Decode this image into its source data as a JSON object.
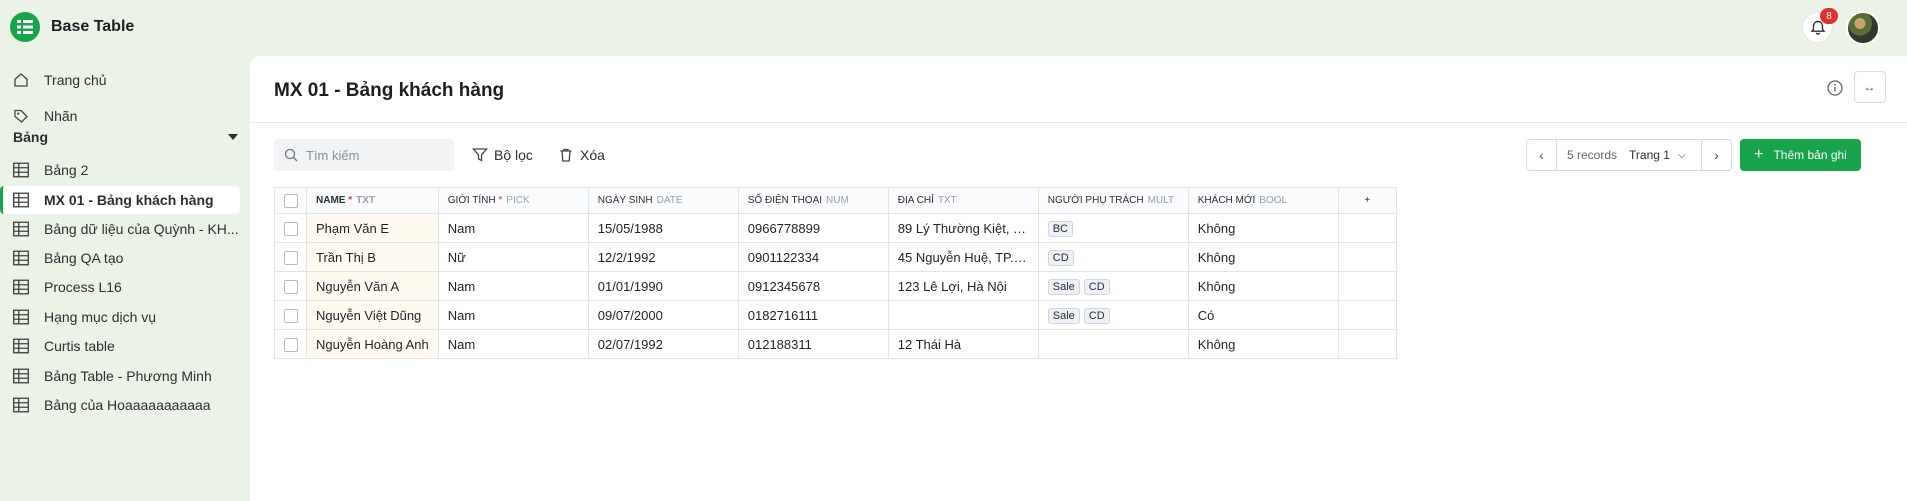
{
  "app": {
    "title": "Base Table",
    "notification_count": "8"
  },
  "sidebar": {
    "nav": [
      {
        "label": "Trang chủ",
        "icon": "home-icon"
      },
      {
        "label": "Nhãn",
        "icon": "tag-icon"
      }
    ],
    "section_title": "Bảng",
    "tables": [
      {
        "label": "Bảng 2"
      },
      {
        "label": "MX 01 - Bảng khách hàng",
        "active": true
      },
      {
        "label": "Bảng dữ liệu của Quỳnh - KH..."
      },
      {
        "label": "Bảng QA tạo"
      },
      {
        "label": "Process L16"
      },
      {
        "label": "Hạng mục dịch vụ"
      },
      {
        "label": "Curtis table"
      },
      {
        "label": "Bảng Table - Phương Minh"
      },
      {
        "label": "Bảng của Hoaaaaaaaaaaa"
      }
    ]
  },
  "main": {
    "title": "MX 01 - Bảng khách hàng",
    "search_placeholder": "Tìm kiếm",
    "filter_label": "Bộ lọc",
    "delete_label": "Xóa",
    "records_label": "5 records",
    "page_label": "Trang 1",
    "add_record_label": "Thêm bản ghi"
  },
  "table": {
    "columns": [
      {
        "name": "NAME",
        "type": "TXT",
        "required": true
      },
      {
        "name": "GIỚI TÍNH",
        "type": "PICK",
        "required": true
      },
      {
        "name": "NGÀY SINH",
        "type": "DATE",
        "required": false
      },
      {
        "name": "SỐ ĐIỆN THOẠI",
        "type": "NUM",
        "required": false
      },
      {
        "name": "ĐỊA CHỈ",
        "type": "TXT",
        "required": false
      },
      {
        "name": "NGƯỜI PHỤ TRÁCH",
        "type": "MULT",
        "required": false
      },
      {
        "name": "KHÁCH MỚI",
        "type": "BOOL",
        "required": false
      }
    ],
    "rows": [
      {
        "name": "Phạm Văn E",
        "gender": "Nam",
        "dob": "15/05/1988",
        "phone": "0966778899",
        "address": "89 Lý Thường Kiệt, H...",
        "owners": [
          "BC"
        ],
        "new": "Không"
      },
      {
        "name": "Trần Thị B",
        "gender": "Nữ",
        "dob": "12/2/1992",
        "phone": "0901122334",
        "address": "45 Nguyễn Huệ, TP.H...",
        "owners": [
          "CD"
        ],
        "new": "Không"
      },
      {
        "name": "Nguyễn Văn A",
        "gender": "Nam",
        "dob": "01/01/1990",
        "phone": "0912345678",
        "address": "123 Lê Lợi, Hà Nội",
        "owners": [
          "Sale",
          "CD"
        ],
        "new": "Không"
      },
      {
        "name": "Nguyễn Việt Dũng",
        "gender": "Nam",
        "dob": "09/07/2000",
        "phone": "0182716111",
        "address": "",
        "owners": [
          "Sale",
          "CD"
        ],
        "new": "Có"
      },
      {
        "name": "Nguyễn Hoàng Anh",
        "gender": "Nam",
        "dob": "02/07/1992",
        "phone": "012188311",
        "address": "12 Thái Hà",
        "owners": [],
        "new": "Không"
      }
    ]
  },
  "colors": {
    "brand": "#17a34a",
    "badge": "#e03131"
  }
}
